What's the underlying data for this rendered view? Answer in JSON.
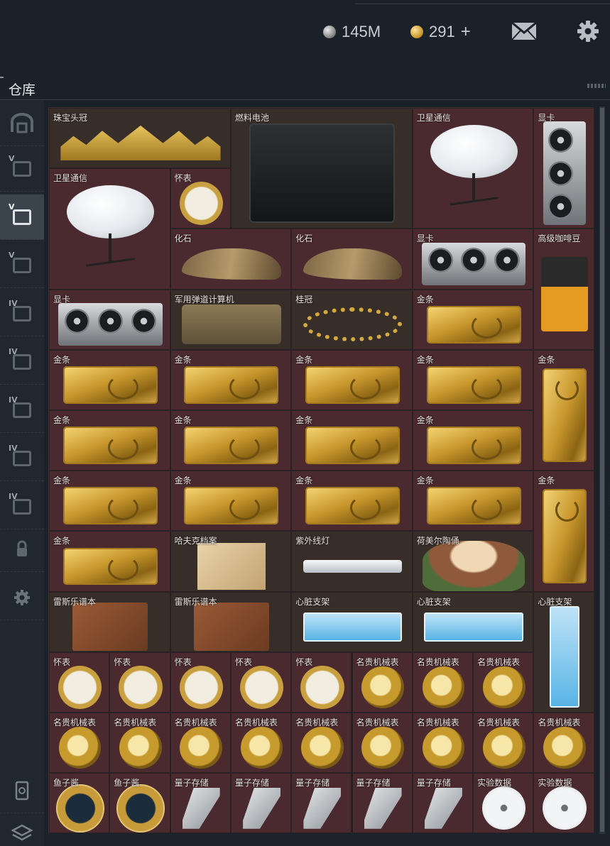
{
  "topbar": {
    "silver_amount": "145M",
    "gold_amount": "291",
    "add_label": "+",
    "mail_icon": "mail-icon",
    "settings_icon": "gear-icon"
  },
  "header": {
    "title": "仓库"
  },
  "sidebar": {
    "tabs": [
      {
        "name": "storage-home-icon",
        "level": ""
      },
      {
        "name": "container-icon",
        "level": "V"
      },
      {
        "name": "container-icon",
        "level": "V"
      },
      {
        "name": "container-icon",
        "level": "V"
      },
      {
        "name": "container-add-icon",
        "level": "IV"
      },
      {
        "name": "container-icon",
        "level": "IV"
      },
      {
        "name": "container-icon",
        "level": "IV"
      },
      {
        "name": "container-icon",
        "level": "IV"
      },
      {
        "name": "container-icon",
        "level": "IV"
      },
      {
        "name": "lock-icon",
        "level": ""
      },
      {
        "name": "gear-icon",
        "level": ""
      },
      {
        "name": "trash-icon",
        "level": ""
      },
      {
        "name": "layers-icon",
        "level": ""
      }
    ]
  },
  "items": [
    {
      "label": "珠宝头冠",
      "kind": "tiara",
      "bg": "brown"
    },
    {
      "label": "燃料电池",
      "kind": "battery",
      "bg": "brown"
    },
    {
      "label": "卫星通信",
      "kind": "dish",
      "bg": "red"
    },
    {
      "label": "显卡",
      "kind": "gpu-v",
      "bg": "red"
    },
    {
      "label": "卫星通信",
      "kind": "dish",
      "bg": "red"
    },
    {
      "label": "怀表",
      "kind": "pocket",
      "bg": "red"
    },
    {
      "label": "化石",
      "kind": "fossil",
      "bg": "red"
    },
    {
      "label": "化石",
      "kind": "fossil",
      "bg": "red"
    },
    {
      "label": "显卡",
      "kind": "gpu",
      "bg": "red"
    },
    {
      "label": "高级咖啡豆",
      "kind": "coffee",
      "bg": "red"
    },
    {
      "label": "显卡",
      "kind": "gpu",
      "bg": "red"
    },
    {
      "label": "军用弹道计算机",
      "kind": "calc",
      "bg": "brown"
    },
    {
      "label": "桂冠",
      "kind": "laurel",
      "bg": "brown"
    },
    {
      "label": "金条",
      "kind": "gold",
      "bg": "red"
    },
    {
      "label": "金条",
      "kind": "gold",
      "bg": "red"
    },
    {
      "label": "金条",
      "kind": "gold",
      "bg": "red"
    },
    {
      "label": "金条",
      "kind": "gold",
      "bg": "red"
    },
    {
      "label": "金条",
      "kind": "gold",
      "bg": "red"
    },
    {
      "label": "金条",
      "kind": "gold-v",
      "bg": "red"
    },
    {
      "label": "金条",
      "kind": "gold",
      "bg": "red"
    },
    {
      "label": "金条",
      "kind": "gold",
      "bg": "red"
    },
    {
      "label": "金条",
      "kind": "gold",
      "bg": "red"
    },
    {
      "label": "金条",
      "kind": "gold",
      "bg": "red"
    },
    {
      "label": "金条",
      "kind": "gold",
      "bg": "red"
    },
    {
      "label": "金条",
      "kind": "gold",
      "bg": "red"
    },
    {
      "label": "金条",
      "kind": "gold",
      "bg": "red"
    },
    {
      "label": "金条",
      "kind": "gold",
      "bg": "red"
    },
    {
      "label": "金条",
      "kind": "gold-v",
      "bg": "red"
    },
    {
      "label": "金条",
      "kind": "gold",
      "bg": "red"
    },
    {
      "label": "哈夫克档案",
      "kind": "folder",
      "bg": "brown"
    },
    {
      "label": "紫外线灯",
      "kind": "uvlamp",
      "bg": "brown"
    },
    {
      "label": "荷美尔陶俑",
      "kind": "figurine",
      "bg": "brown"
    },
    {
      "label": "雷斯乐谱本",
      "kind": "book",
      "bg": "brown"
    },
    {
      "label": "雷斯乐谱本",
      "kind": "book",
      "bg": "brown"
    },
    {
      "label": "心脏支架",
      "kind": "stent",
      "bg": "brown"
    },
    {
      "label": "心脏支架",
      "kind": "stent",
      "bg": "brown"
    },
    {
      "label": "心脏支架",
      "kind": "stent-v",
      "bg": "brown"
    },
    {
      "label": "怀表",
      "kind": "pocket",
      "bg": "red"
    },
    {
      "label": "怀表",
      "kind": "pocket",
      "bg": "red"
    },
    {
      "label": "怀表",
      "kind": "pocket",
      "bg": "red"
    },
    {
      "label": "怀表",
      "kind": "pocket",
      "bg": "red"
    },
    {
      "label": "怀表",
      "kind": "pocket",
      "bg": "red"
    },
    {
      "label": "名贵机械表",
      "kind": "watch",
      "bg": "red"
    },
    {
      "label": "名贵机械表",
      "kind": "watch",
      "bg": "red"
    },
    {
      "label": "名贵机械表",
      "kind": "watch",
      "bg": "red"
    },
    {
      "label": "名贵机械表",
      "kind": "watch",
      "bg": "red"
    },
    {
      "label": "名贵机械表",
      "kind": "watch",
      "bg": "red"
    },
    {
      "label": "名贵机械表",
      "kind": "watch",
      "bg": "red"
    },
    {
      "label": "名贵机械表",
      "kind": "watch",
      "bg": "red"
    },
    {
      "label": "名贵机械表",
      "kind": "watch",
      "bg": "red"
    },
    {
      "label": "名贵机械表",
      "kind": "watch",
      "bg": "red"
    },
    {
      "label": "名贵机械表",
      "kind": "watch",
      "bg": "red"
    },
    {
      "label": "名贵机械表",
      "kind": "watch",
      "bg": "red"
    },
    {
      "label": "名贵机械表",
      "kind": "watch",
      "bg": "red"
    },
    {
      "label": "鱼子酱",
      "kind": "tin",
      "bg": "red"
    },
    {
      "label": "鱼子酱",
      "kind": "tin",
      "bg": "red"
    },
    {
      "label": "量子存储",
      "kind": "usb",
      "bg": "red"
    },
    {
      "label": "量子存储",
      "kind": "usb",
      "bg": "red"
    },
    {
      "label": "量子存储",
      "kind": "usb",
      "bg": "red"
    },
    {
      "label": "量子存储",
      "kind": "usb",
      "bg": "red"
    },
    {
      "label": "量子存储",
      "kind": "usb",
      "bg": "red"
    },
    {
      "label": "实验数据",
      "kind": "disc",
      "bg": "red"
    },
    {
      "label": "实验数据",
      "kind": "disc",
      "bg": "red"
    }
  ]
}
